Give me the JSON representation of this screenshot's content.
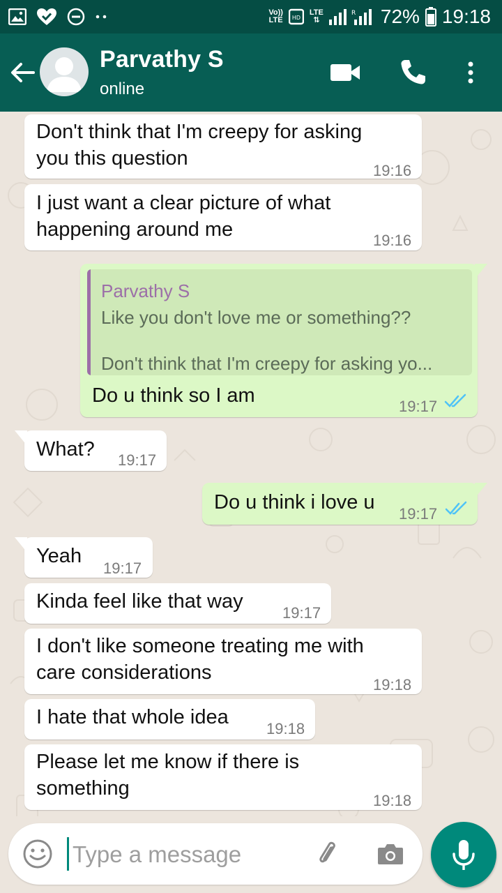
{
  "status_bar": {
    "network_label_top": "Vo))",
    "network_label_bottom": "LTE",
    "lte_label": "LTE",
    "battery": "72%",
    "time": "19:18"
  },
  "header": {
    "contact_name": "Parvathy S",
    "contact_status": "online"
  },
  "messages": [
    {
      "dir": "in",
      "text": "Don't think that I'm creepy for asking\nyou this question",
      "time": "19:16"
    },
    {
      "dir": "in",
      "text": "I just want a clear picture of what\nhappening around me",
      "time": "19:16"
    },
    {
      "dir": "out",
      "quote_author": "Parvathy S",
      "quote_line1": "Like you don't love me or something??",
      "quote_line2": "Don't think that I'm creepy for asking yo...",
      "text": "Do u think so I am",
      "time": "19:17",
      "status": "read"
    },
    {
      "dir": "in",
      "text": "What?",
      "time": "19:17"
    },
    {
      "dir": "out",
      "text": "Do u think i love u",
      "time": "19:17",
      "status": "read"
    },
    {
      "dir": "in",
      "text": "Yeah",
      "time": "19:17"
    },
    {
      "dir": "in",
      "text": "Kinda feel like that way",
      "time": "19:17"
    },
    {
      "dir": "in",
      "text": "I don't like someone treating me with\ncare considerations",
      "time": "19:18"
    },
    {
      "dir": "in",
      "text": "I hate that whole idea",
      "time": "19:18"
    },
    {
      "dir": "in",
      "text": "Please let me know if there is\nsomething",
      "time": "19:18"
    }
  ],
  "composer": {
    "placeholder": "Type a message"
  },
  "colors": {
    "header": "#075e54",
    "status_bar": "#054d44",
    "incoming_bubble": "#ffffff",
    "outgoing_bubble": "#dcf8c6",
    "accent": "#00897b",
    "read_ticks": "#4fc3f7",
    "quote_author": "#9c6fa8"
  },
  "icons": [
    "gallery-icon",
    "heart-check-icon",
    "dnd-icon",
    "more-dots-icon",
    "data-icon",
    "signal-icon",
    "battery-icon",
    "back-arrow-icon",
    "avatar-icon",
    "video-call-icon",
    "phone-icon",
    "overflow-menu-icon",
    "emoji-icon",
    "attach-icon",
    "camera-icon",
    "mic-icon",
    "double-check-icon"
  ]
}
